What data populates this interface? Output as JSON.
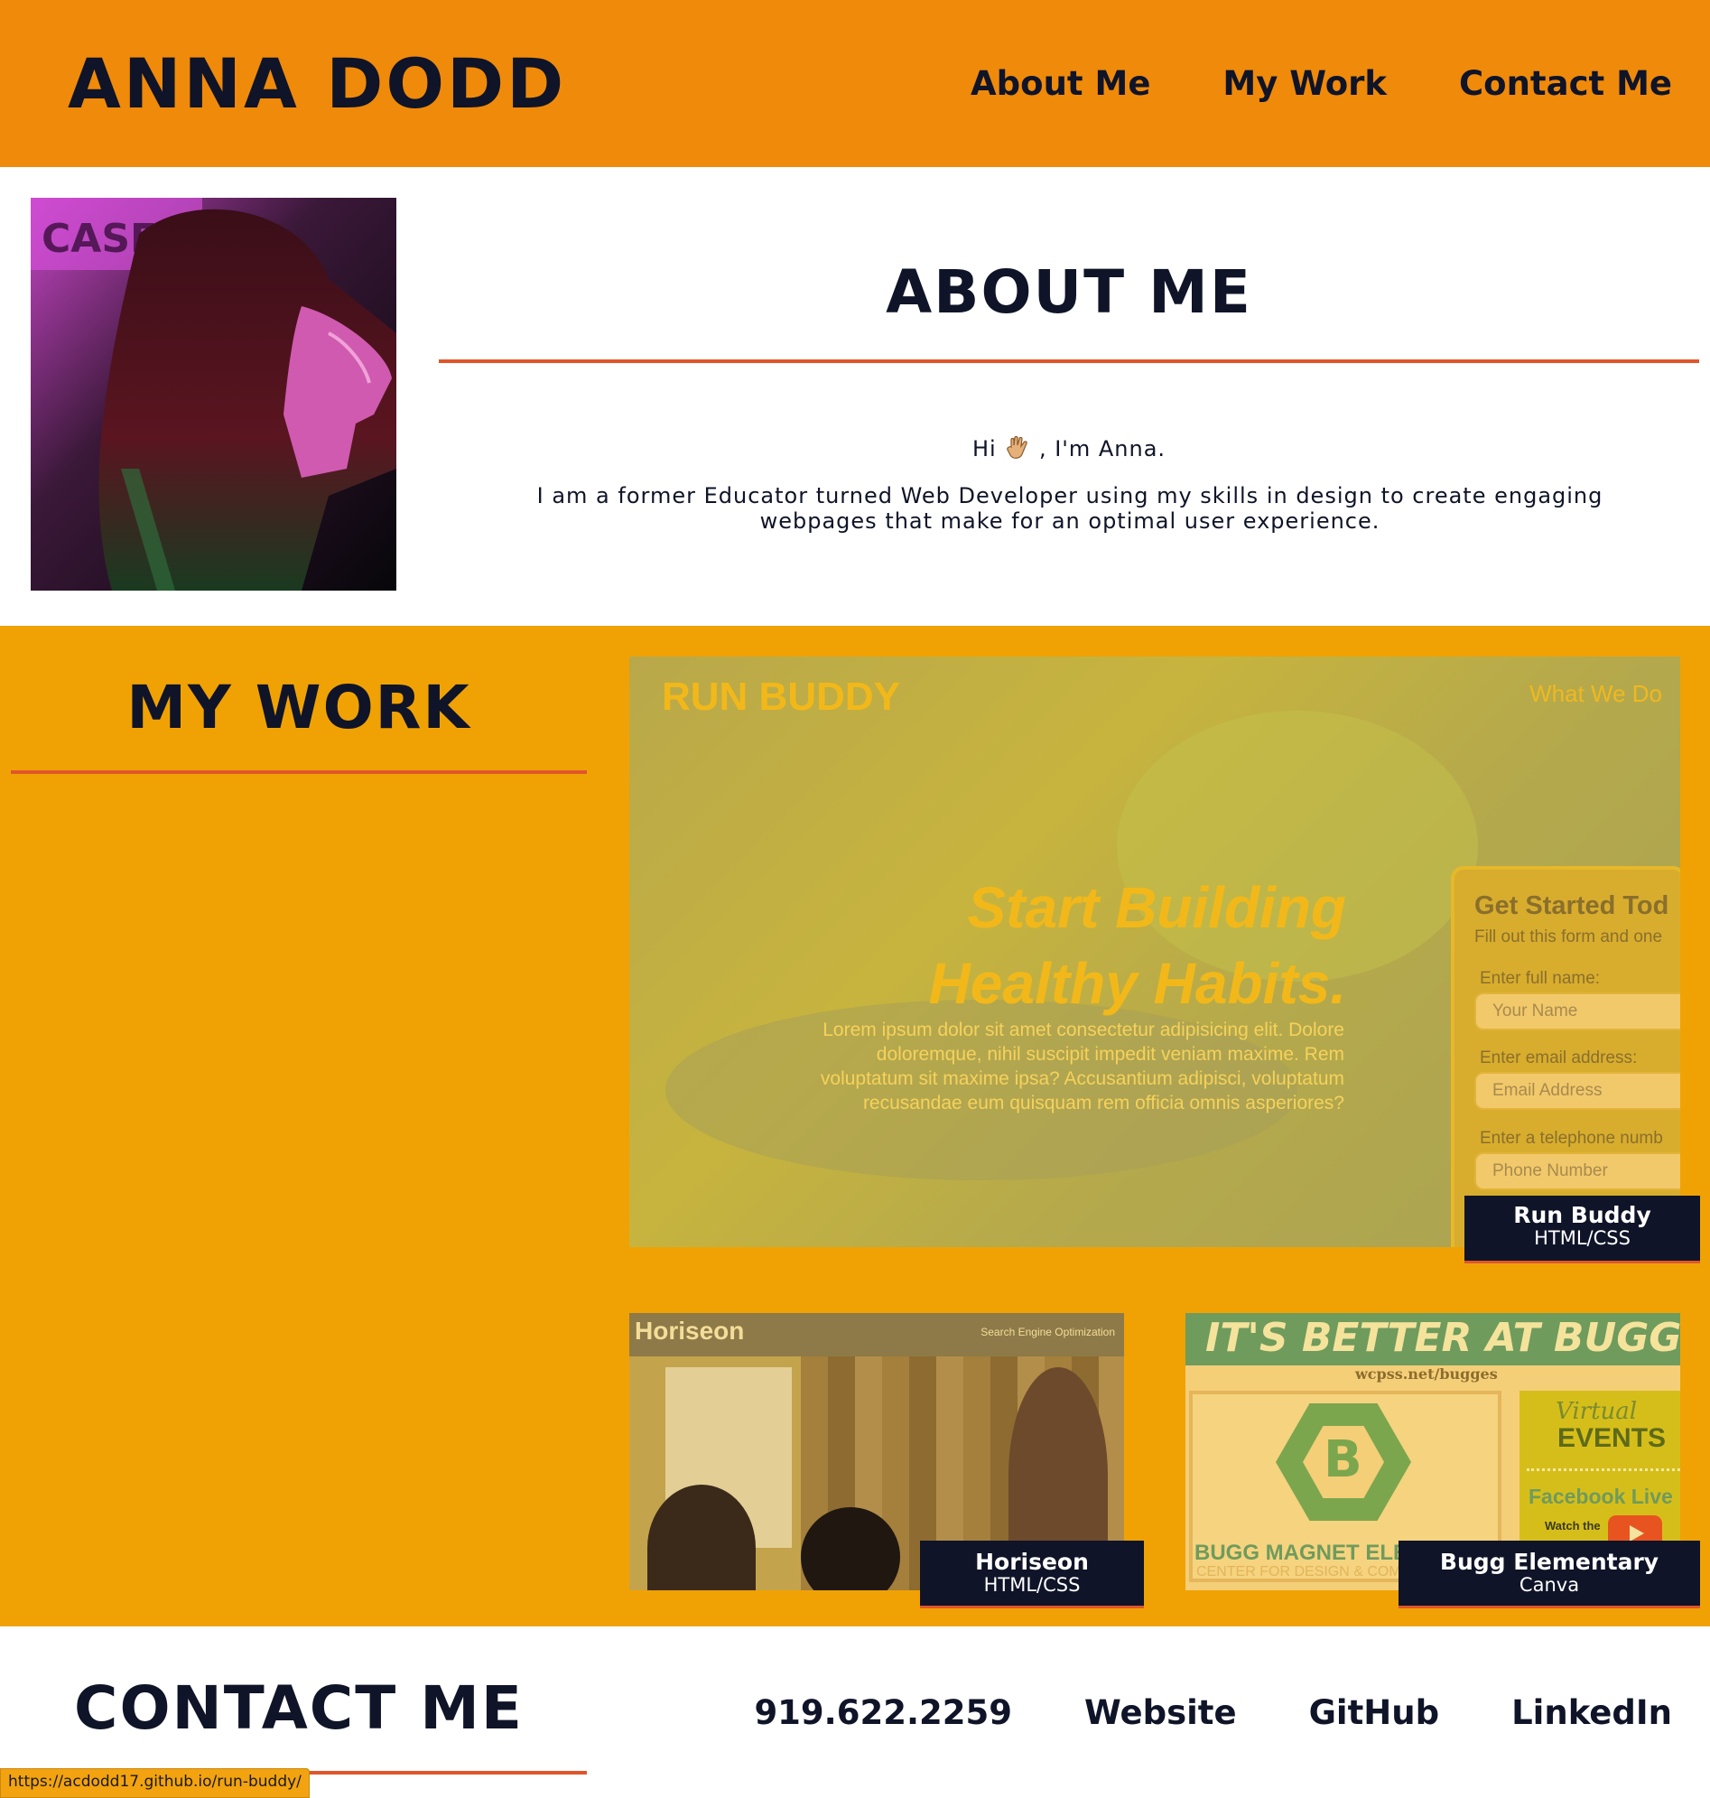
{
  "header": {
    "brand": "ANNA DODD",
    "nav": [
      "About Me",
      "My Work",
      "Contact Me"
    ]
  },
  "about": {
    "title": "ABOUT ME",
    "greeting_prefix": "Hi",
    "greeting_suffix": ", I'm Anna.",
    "greeting_icon": "waving-hand-icon",
    "bio": "I am a former Educator turned Web Developer using my skills in design to create engaging webpages that make for an optimal user experience."
  },
  "work": {
    "title": "MY WORK",
    "projects": [
      {
        "name": "Run Buddy",
        "tech": "HTML/CSS",
        "preview": {
          "logo": "RUN BUDDY",
          "nav": "What We Do",
          "headline_1": "Start Building",
          "headline_2": "Healthy Habits.",
          "body": "Lorem ipsum dolor sit amet consectetur adipisicing elit. Dolore doloremque, nihil suscipit impedit veniam maxime. Rem voluptatum sit maxime ipsa? Accusantium adipisci, voluptatum recusandae eum quisquam rem officia omnis asperiores?",
          "form_title": "Get Started Tod",
          "form_subtitle": "Fill out this form and one",
          "label_name": "Enter full name:",
          "placeholder_name": "Your Name",
          "label_email": "Enter email address:",
          "placeholder_email": "Email Address",
          "label_phone": "Enter a telephone numb",
          "placeholder_phone": "Phone Number"
        }
      },
      {
        "name": "Horiseon",
        "tech": "HTML/CSS",
        "preview": {
          "logo": "Horiseon",
          "tag": "Search Engine Optimization"
        }
      },
      {
        "name": "Bugg Elementary",
        "tech": "Canva",
        "preview": {
          "headline": "IT'S BETTER AT BUGG!",
          "url": "wcpss.net/bugges",
          "school": "BUGG MAGNET ELE",
          "school_sub": "CENTER FOR DESIGN & COMPU",
          "virtual": "Virtual",
          "events": "EVENTS",
          "facebook": "Facebook Live",
          "watch": "Watch the"
        }
      }
    ]
  },
  "contact": {
    "title": "CONTACT ME",
    "links": [
      "919.622.2259",
      "Website",
      "GitHub",
      "LinkedIn"
    ]
  },
  "status_bar": {
    "url": "https://acdodd17.github.io/run-buddy/"
  },
  "colors": {
    "header_bg": "#f08a0a",
    "work_bg": "#f0a205",
    "accent_rule": "#e0552b",
    "navy": "#0f1428"
  }
}
